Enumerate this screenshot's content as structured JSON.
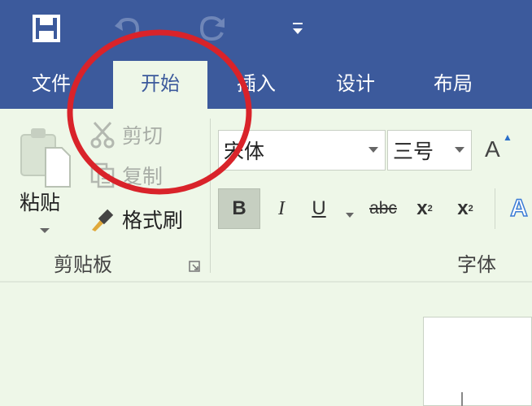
{
  "app": {
    "accent": "#3c5a9c",
    "ribbon_bg": "#eef7e8"
  },
  "quick_access": {
    "save_icon": "save-icon",
    "undo_icon": "undo-icon",
    "redo_icon": "redo-icon",
    "customize_icon": "customize-quick-access-icon"
  },
  "tabs": [
    {
      "label": "文件",
      "active": false
    },
    {
      "label": "开始",
      "active": true
    },
    {
      "label": "插入",
      "active": false
    },
    {
      "label": "设计",
      "active": false
    },
    {
      "label": "布局",
      "active": false
    }
  ],
  "clipboard": {
    "paste_label": "粘贴",
    "cut_label": "剪切",
    "copy_label": "复制",
    "format_painter_label": "格式刷",
    "group_label": "剪贴板"
  },
  "font": {
    "font_name": "宋体",
    "font_size": "三号",
    "grow_font_label": "A",
    "bold_label": "B",
    "italic_label": "I",
    "underline_label": "U",
    "strike_label": "abc",
    "subscript_label": "x",
    "subscript_mark": "2",
    "superscript_label": "x",
    "superscript_mark": "2",
    "text_effects_label": "A",
    "group_label": "字体"
  },
  "annotation": {
    "shape": "circle",
    "color": "#d9232a",
    "target": "tab-home"
  }
}
